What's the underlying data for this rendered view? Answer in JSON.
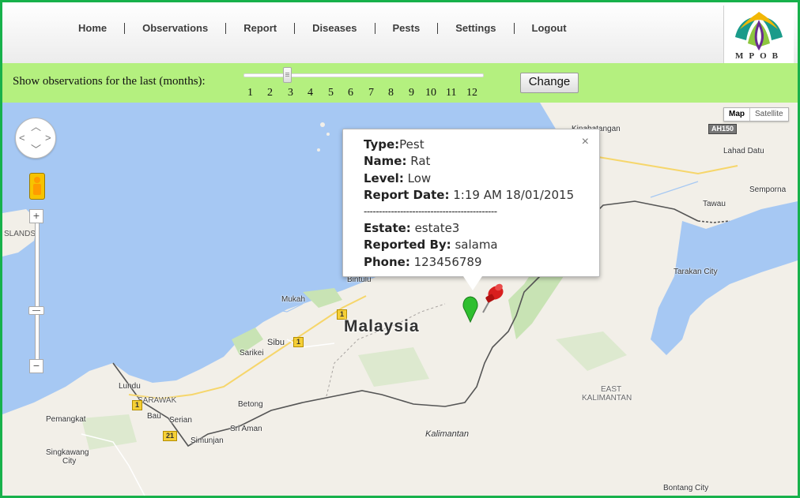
{
  "nav": {
    "items": [
      {
        "label": "Home"
      },
      {
        "label": "Observations"
      },
      {
        "label": "Report"
      },
      {
        "label": "Diseases"
      },
      {
        "label": "Pests"
      },
      {
        "label": "Settings"
      },
      {
        "label": "Logout"
      }
    ]
  },
  "logo": {
    "text": "MPOB"
  },
  "filter": {
    "label": "Show observations for the last (months):",
    "slider_value": 3,
    "ticks": [
      "1",
      "2",
      "3",
      "4",
      "5",
      "6",
      "7",
      "8",
      "9",
      "10",
      "11",
      "12"
    ],
    "change_label": "Change"
  },
  "map": {
    "type_controls": {
      "map": "Map",
      "satellite": "Satellite"
    },
    "zoom": {
      "in": "+",
      "out": "−",
      "mid": "−"
    },
    "country_label": "Malaysia",
    "labels": {
      "islands": "SLANDS",
      "bintulu": "Bintulu",
      "mukah": "Mukah",
      "sibu": "Sibu",
      "sarikei": "Sarikei",
      "betong": "Betong",
      "lundu": "Lundu",
      "sarawak": "SARAWAK",
      "bau": "Bau",
      "serian": "Serian",
      "sri_aman": "Sri Aman",
      "simunjan": "Simunjan",
      "pemangkat": "Pemangkat",
      "singkawang": "Singkawang",
      "city": "City",
      "kalimantan": "Kalimantan",
      "east": "EAST",
      "east_kalimantan": "KALIMANTAN",
      "lahad_datu": "Lahad Datu",
      "tawau": "Tawau",
      "semporna": "Semporna",
      "tarakan_city": "Tarakan City",
      "kinabatangan": "Kinabatangan",
      "bontang": "Bontang City"
    },
    "road_shields": {
      "r1a": "1",
      "r1b": "1",
      "r1c": "1",
      "r21": "21",
      "ah150": "AH150"
    }
  },
  "info_window": {
    "type_label": "Type:",
    "type_value": "Pest",
    "name_label": "Name:",
    "name_value": " Rat",
    "level_label": "Level:",
    "level_value": " Low",
    "date_label": "Report Date:",
    "date_value": " 1:19 AM 18/01/2015",
    "separator": "--------------------------------------------",
    "estate_label": "Estate:",
    "estate_value": " estate3",
    "reported_label": "Reported By:",
    "reported_value": " salama",
    "phone_label": "Phone:",
    "phone_value": " 123456789",
    "close": "×"
  },
  "colors": {
    "frame": "#17b14b",
    "filter_bar": "#b4f07f",
    "sea": "#a6c8f3",
    "land": "#f2efe8",
    "forest": "#c8e3b4",
    "marker_green": "#2fbf2f",
    "marker_red": "#d81e1e"
  }
}
